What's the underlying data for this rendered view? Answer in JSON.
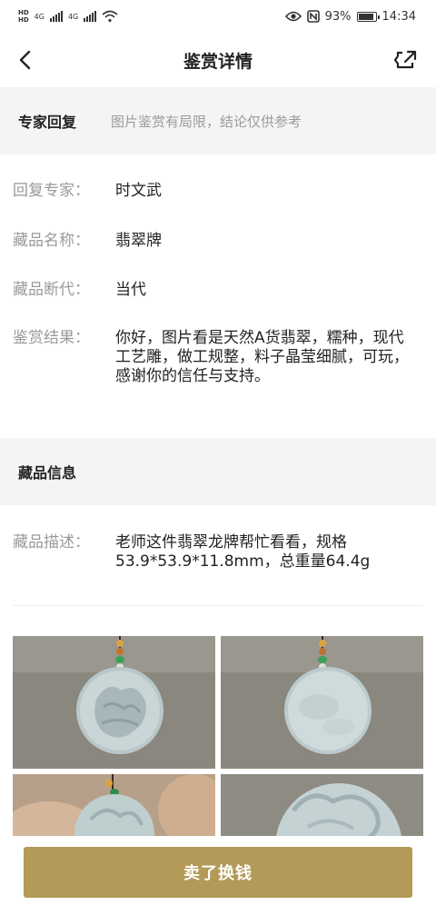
{
  "status_bar": {
    "network_tags": [
      "HD",
      "HD"
    ],
    "signal_labels": [
      "4G",
      "4G"
    ],
    "battery_level": "93%",
    "time": "14:34",
    "icons": [
      "eye-icon",
      "nfc-icon",
      "battery-icon",
      "wifi-icon",
      "signal-icon"
    ]
  },
  "nav": {
    "title": "鉴赏详情",
    "back_icon": "chevron-left-icon",
    "share_icon": "share-icon"
  },
  "expert_reply": {
    "section_title": "专家回复",
    "note": "图片鉴赏有局限，结论仅供参考",
    "rows": [
      {
        "label": "回复专家：",
        "value": "时文武"
      },
      {
        "label": "藏品名称：",
        "value": "翡翠牌"
      },
      {
        "label": "藏品断代：",
        "value": "当代"
      },
      {
        "label": "鉴赏结果：",
        "value": "你好，图片看是天然A货翡翠，糯种，现代工艺雕，做工规整，料子晶莹细腻，可玩，感谢你的信任与支持。"
      }
    ]
  },
  "item_info": {
    "section_title": "藏品信息",
    "rows": [
      {
        "label": "藏品描述：",
        "value": "老师这件翡翠龙牌帮忙看看，规格53.9*53.9*11.8mm，总重量64.4g"
      }
    ]
  },
  "photos": [
    {
      "name": "photo-dragon-front"
    },
    {
      "name": "photo-plain-back"
    },
    {
      "name": "photo-in-hand"
    },
    {
      "name": "photo-carving-closeup"
    }
  ],
  "bottom": {
    "sell_label": "卖了换钱"
  },
  "colors": {
    "accent": "#b49a58",
    "section_bg": "#f4f4f4",
    "label_gray": "#9a9a9a"
  }
}
